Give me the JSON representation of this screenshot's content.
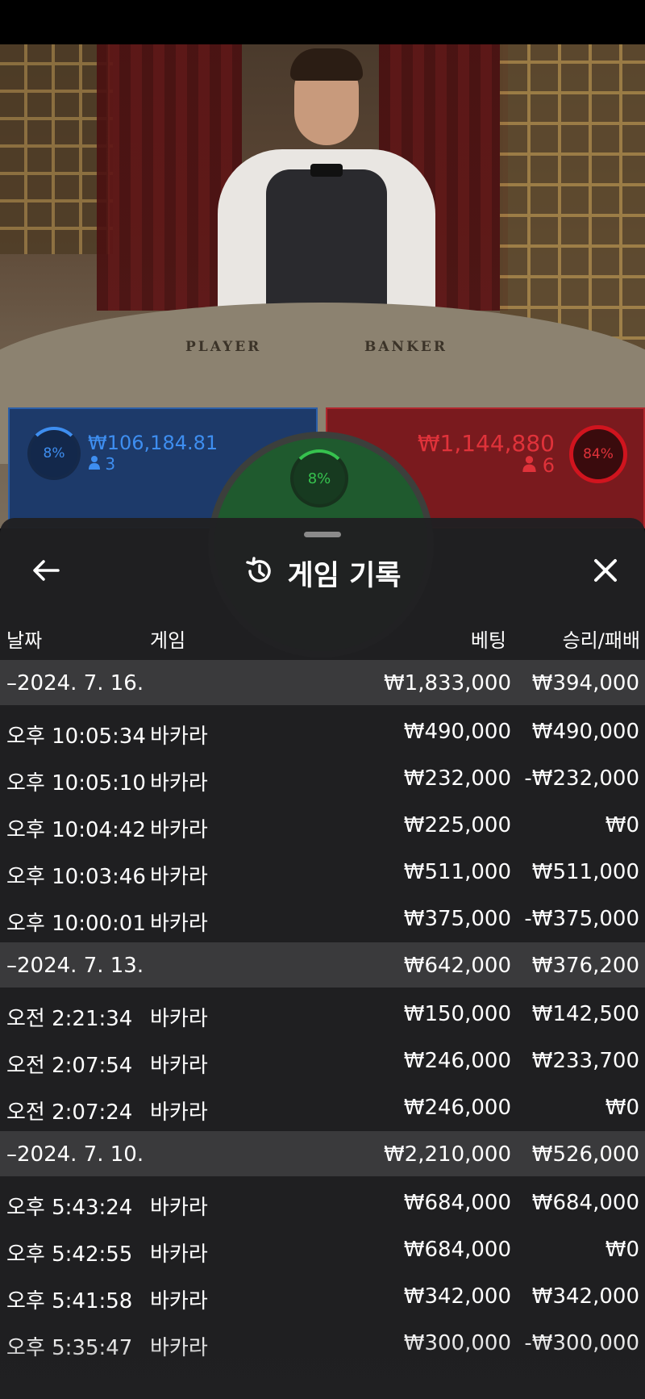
{
  "table": {
    "player_label": "PLAYER",
    "banker_label": "BANKER"
  },
  "bets": {
    "player": {
      "percent": "8%",
      "amount": "₩106,184.81",
      "count": "3"
    },
    "banker": {
      "percent": "84%",
      "amount": "₩1,144,880",
      "count": "6"
    },
    "tie": {
      "percent": "8%"
    }
  },
  "sheet": {
    "title": "게임 기록",
    "columns": {
      "date": "날짜",
      "game": "게임",
      "bet": "베팅",
      "result": "승리/패배"
    },
    "rows": [
      {
        "type": "date",
        "time": "–2024. 7. 16.",
        "game": "",
        "bet": "₩1,833,000",
        "result": "₩394,000"
      },
      {
        "type": "game",
        "time": "오후 10:05:34",
        "game": "바카라",
        "bet": "₩490,000",
        "result": "₩490,000"
      },
      {
        "type": "game",
        "time": "오후 10:05:10",
        "game": "바카라",
        "bet": "₩232,000",
        "result": "-₩232,000"
      },
      {
        "type": "game",
        "time": "오후 10:04:42",
        "game": "바카라",
        "bet": "₩225,000",
        "result": "₩0"
      },
      {
        "type": "game",
        "time": "오후 10:03:46",
        "game": "바카라",
        "bet": "₩511,000",
        "result": "₩511,000"
      },
      {
        "type": "game",
        "time": "오후 10:00:01",
        "game": "바카라",
        "bet": "₩375,000",
        "result": "-₩375,000"
      },
      {
        "type": "date",
        "time": "–2024. 7. 13.",
        "game": "",
        "bet": "₩642,000",
        "result": "₩376,200"
      },
      {
        "type": "game",
        "time": "오전 2:21:34",
        "game": "바카라",
        "bet": "₩150,000",
        "result": "₩142,500"
      },
      {
        "type": "game",
        "time": "오전 2:07:54",
        "game": "바카라",
        "bet": "₩246,000",
        "result": "₩233,700"
      },
      {
        "type": "game",
        "time": "오전 2:07:24",
        "game": "바카라",
        "bet": "₩246,000",
        "result": "₩0"
      },
      {
        "type": "date",
        "time": "–2024. 7. 10.",
        "game": "",
        "bet": "₩2,210,000",
        "result": "₩526,000"
      },
      {
        "type": "game",
        "time": "오후 5:43:24",
        "game": "바카라",
        "bet": "₩684,000",
        "result": "₩684,000"
      },
      {
        "type": "game",
        "time": "오후 5:42:55",
        "game": "바카라",
        "bet": "₩684,000",
        "result": "₩0"
      },
      {
        "type": "game",
        "time": "오후 5:41:58",
        "game": "바카라",
        "bet": "₩342,000",
        "result": "₩342,000"
      },
      {
        "type": "game",
        "time": "오후 5:35:47",
        "game": "바카라",
        "bet": "₩300,000",
        "result": "-₩300,000"
      }
    ]
  },
  "icons": {
    "back": "arrow-left-icon",
    "history": "history-icon",
    "close": "close-icon",
    "person": "person-icon"
  },
  "colors": {
    "player": "#3e8ef0",
    "banker": "#e0323a",
    "tie": "#36c24e",
    "sheet_bg": "#202022",
    "date_row_bg": "#3a3a3c"
  }
}
